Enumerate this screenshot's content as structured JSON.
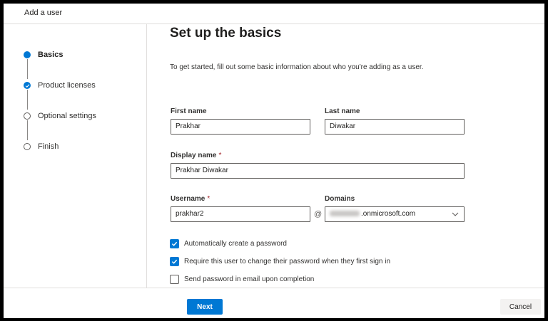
{
  "window": {
    "title": "Add a user"
  },
  "steps": [
    {
      "label": "Basics",
      "state": "current"
    },
    {
      "label": "Product licenses",
      "state": "done"
    },
    {
      "label": "Optional settings",
      "state": "pending"
    },
    {
      "label": "Finish",
      "state": "pending"
    }
  ],
  "main": {
    "heading": "Set up the basics",
    "intro": "To get started, fill out some basic information about who you're adding as a user.",
    "first_name": {
      "label": "First name",
      "value": "Prakhar"
    },
    "last_name": {
      "label": "Last name",
      "value": "Diwakar"
    },
    "display_name": {
      "label": "Display name",
      "required_mark": "*",
      "value": "Prakhar Diwakar"
    },
    "username": {
      "label": "Username",
      "required_mark": "*",
      "value": "prakhar2"
    },
    "at_symbol": "@",
    "domains": {
      "label": "Domains",
      "value_suffix": ".onmicrosoft.com"
    },
    "options": [
      {
        "label": "Automatically create a password",
        "checked": true
      },
      {
        "label": "Require this user to change their password when they first sign in",
        "checked": true
      },
      {
        "label": "Send password in email upon completion",
        "checked": false
      }
    ]
  },
  "footer": {
    "next_label": "Next",
    "cancel_label": "Cancel"
  },
  "colors": {
    "accent": "#0078d4",
    "required": "#a4262c",
    "border": "#605e5c"
  }
}
